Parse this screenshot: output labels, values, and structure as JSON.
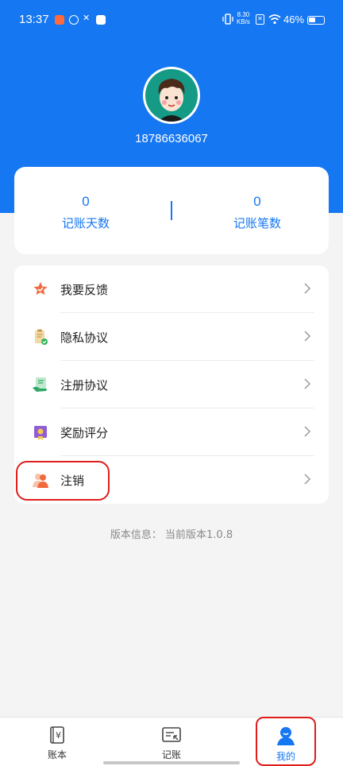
{
  "status_bar": {
    "time": "13:37",
    "net_speed_top": "8.30",
    "net_speed_bottom": "KB/s",
    "battery": "46%"
  },
  "profile": {
    "phone": "18786636067"
  },
  "stats": {
    "days": {
      "value": "0",
      "label": "记账天数"
    },
    "entries": {
      "value": "0",
      "label": "记账笔数"
    }
  },
  "menu": {
    "items": [
      {
        "label": "我要反馈",
        "icon": "feedback-icon"
      },
      {
        "label": "隐私协议",
        "icon": "privacy-icon"
      },
      {
        "label": "注册协议",
        "icon": "register-icon"
      },
      {
        "label": "奖励评分",
        "icon": "rating-icon"
      },
      {
        "label": "注销",
        "icon": "logout-icon"
      }
    ]
  },
  "version": "版本信息： 当前版本1.0.8",
  "tabbar": {
    "tabs": [
      {
        "label": "账本",
        "icon": "ledger-icon"
      },
      {
        "label": "记账",
        "icon": "record-icon"
      },
      {
        "label": "我的",
        "icon": "profile-icon",
        "active": true
      }
    ]
  },
  "colors": {
    "primary": "#1677f2",
    "highlight": "#e01d1d",
    "background": "#f4f4f4"
  }
}
